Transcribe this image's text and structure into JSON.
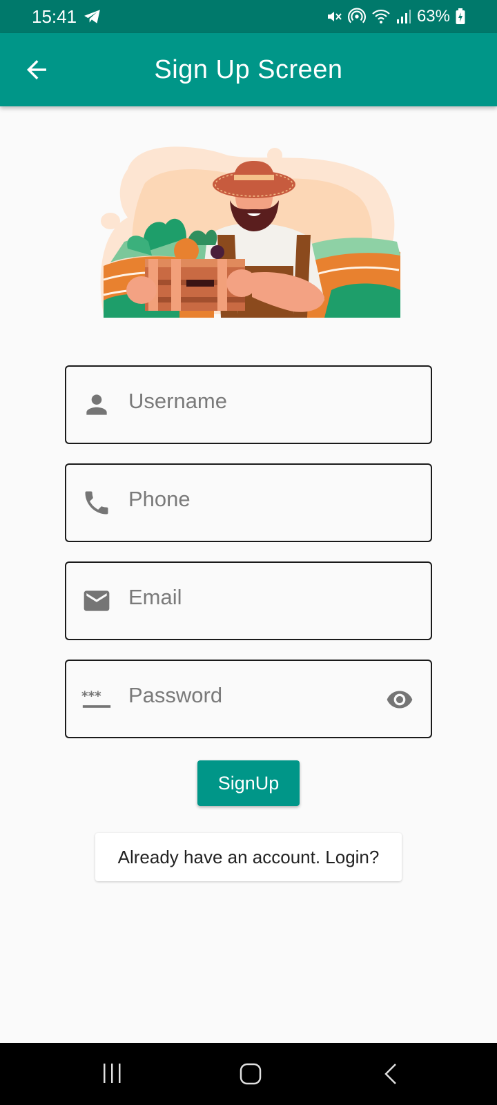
{
  "status_bar": {
    "time": "15:41",
    "battery": "63%",
    "icons": [
      "telegram-icon",
      "mute-icon",
      "hotspot-icon",
      "wifi-icon",
      "signal-icon",
      "battery-icon"
    ]
  },
  "app_bar": {
    "title": "Sign Up Screen",
    "back_icon": "arrow-back-icon"
  },
  "form": {
    "username": {
      "placeholder": "Username",
      "icon": "person-icon"
    },
    "phone": {
      "placeholder": "Phone",
      "icon": "phone-icon"
    },
    "email": {
      "placeholder": "Email",
      "icon": "mail-icon"
    },
    "password": {
      "placeholder": "Password",
      "icon": "password-icon",
      "toggle_icon": "visibility-icon"
    }
  },
  "buttons": {
    "signup": "SignUp",
    "login": "Already have an account. Login?"
  },
  "colors": {
    "primary": "#009688",
    "primary_dark": "#00796b",
    "background": "#fafafa"
  }
}
